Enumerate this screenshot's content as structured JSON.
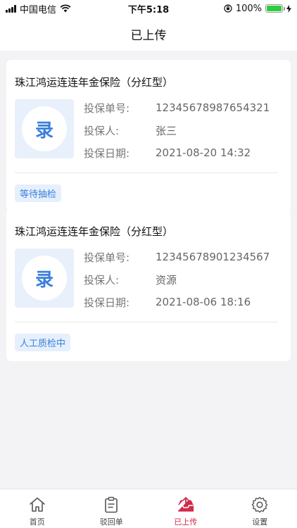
{
  "status": {
    "carrier": "中国电信",
    "time": "下午5:18",
    "battery": "100%",
    "battery_level": 1.0
  },
  "header": {
    "title": "已上传"
  },
  "records": [
    {
      "title": "珠江鸿运连连年金保险（分红型）",
      "thumb_text": "录",
      "fields": [
        {
          "label": "投保单号:",
          "value": "12345678987654321"
        },
        {
          "label": "投保人:",
          "value": "张三"
        },
        {
          "label": "投保日期:",
          "value": "2021-08-20 14:32"
        }
      ],
      "status": "等待抽检"
    },
    {
      "title": "珠江鸿运连连年金保险（分红型）",
      "thumb_text": "录",
      "fields": [
        {
          "label": "投保单号:",
          "value": "12345678901234567"
        },
        {
          "label": "投保人:",
          "value": "资源"
        },
        {
          "label": "投保日期:",
          "value": "2021-08-06 18:16"
        }
      ],
      "status": "人工质检中"
    }
  ],
  "tabbar": {
    "active_color": "#d12a4b",
    "items": [
      {
        "label": "首页",
        "icon": "home-icon"
      },
      {
        "label": "驳回单",
        "icon": "clipboard-icon"
      },
      {
        "label": "已上传",
        "icon": "upload-tray-icon"
      },
      {
        "label": "设置",
        "icon": "gear-icon"
      }
    ]
  }
}
